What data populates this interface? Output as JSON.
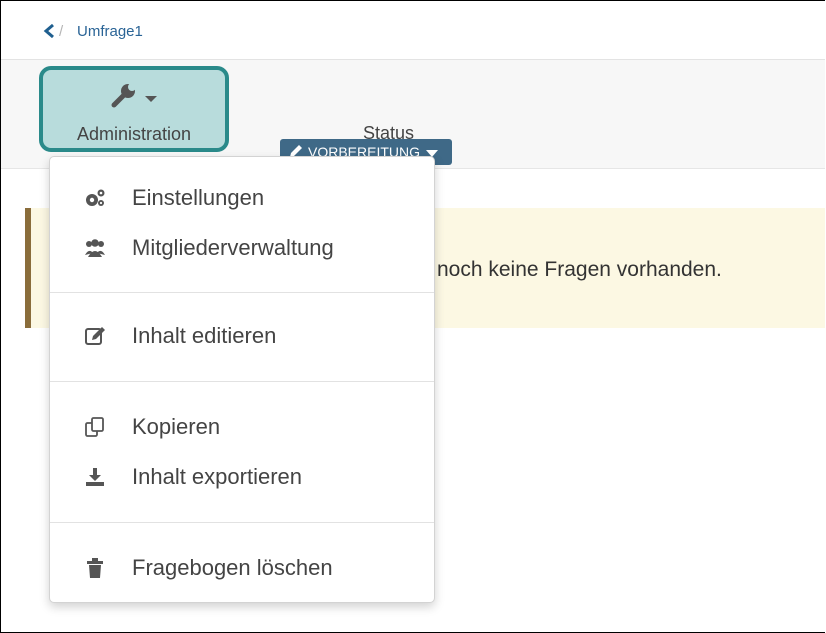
{
  "breadcrumb": {
    "back_icon": "chevron-left-icon",
    "separator": "/",
    "current": "Umfrage1"
  },
  "toolbar": {
    "admin_icon": "wrench-icon",
    "admin_label": "Administration",
    "status_badge": "VORBEREITUNG",
    "status_label": "Status"
  },
  "warning": {
    "text": "noch keine Fragen vorhanden."
  },
  "menu": {
    "items": [
      {
        "label": "Einstellungen",
        "icon": "cogs-icon"
      },
      {
        "label": "Mitgliederverwaltung",
        "icon": "users-icon"
      },
      {
        "label": "Inhalt editieren",
        "icon": "edit-icon"
      },
      {
        "label": "Kopieren",
        "icon": "copy-icon"
      },
      {
        "label": "Inhalt exportieren",
        "icon": "download-icon"
      },
      {
        "label": "Fragebogen löschen",
        "icon": "trash-icon"
      }
    ]
  },
  "colors": {
    "accent_border": "#2a8a8a",
    "admin_bg": "#b8dcdc",
    "badge_bg": "#3f6987",
    "link": "#2a6496",
    "warning_bg": "#fcf8e3",
    "warning_border": "#8a6d3b"
  }
}
